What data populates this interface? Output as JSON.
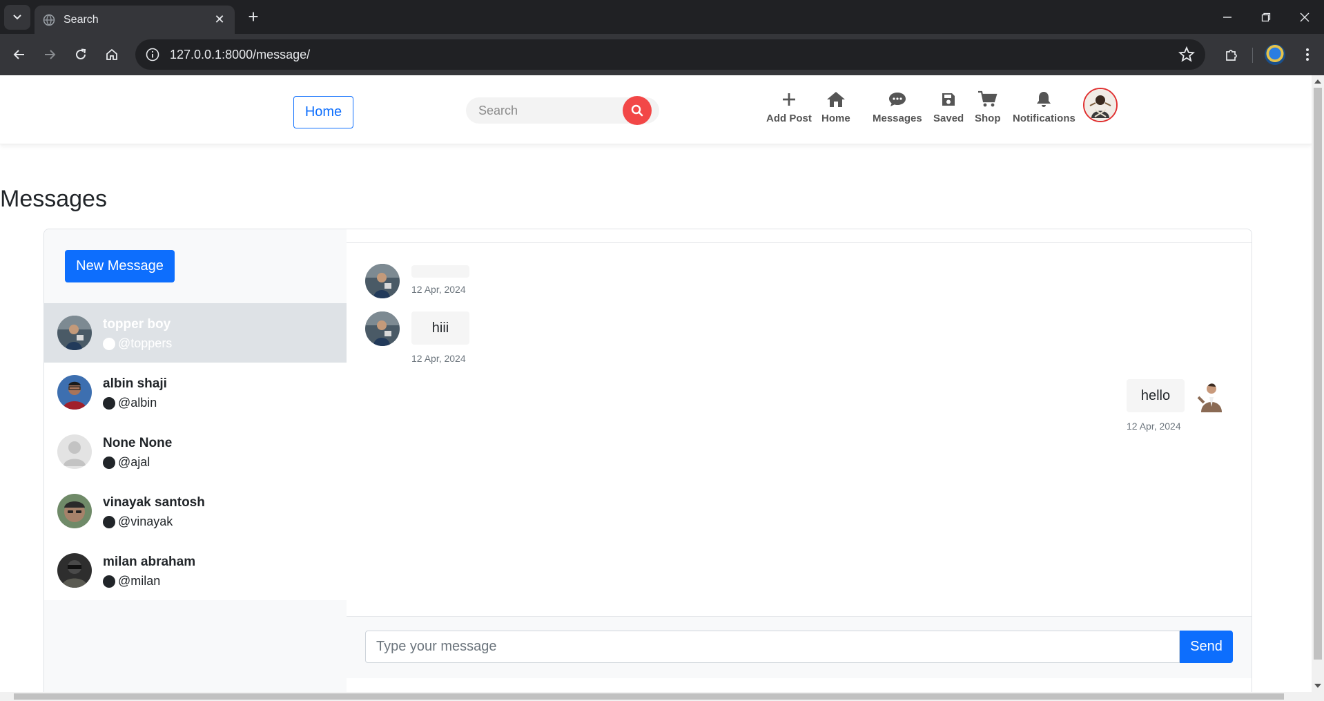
{
  "browser": {
    "tab_title": "Search",
    "url": "127.0.0.1:8000/message/"
  },
  "nav": {
    "home_label": "Home",
    "search_placeholder": "Search",
    "items": [
      {
        "label": "Add Post",
        "icon": "plus-icon"
      },
      {
        "label": "Home",
        "icon": "home-icon"
      },
      {
        "label": "Messages",
        "icon": "chat-bubble-icon"
      },
      {
        "label": "Saved",
        "icon": "floppy-disk-icon"
      },
      {
        "label": "Shop",
        "icon": "cart-icon"
      },
      {
        "label": "Notifications",
        "icon": "bell-icon"
      }
    ],
    "accent": "#f24747"
  },
  "page": {
    "title": "Messages"
  },
  "sidebar": {
    "new_message_label": "New Message",
    "contacts": [
      {
        "name": "topper boy",
        "handle": "@toppers",
        "active": true
      },
      {
        "name": "albin shaji",
        "handle": "@albin",
        "active": false
      },
      {
        "name": "None None",
        "handle": "@ajal",
        "active": false
      },
      {
        "name": "vinayak santosh",
        "handle": "@vinayak",
        "active": false
      },
      {
        "name": "milan abraham",
        "handle": "@milan",
        "active": false
      }
    ]
  },
  "chat": {
    "messages": [
      {
        "text": "",
        "time": "12 Apr, 2024",
        "from": "other"
      },
      {
        "text": "hiii",
        "time": "12 Apr, 2024",
        "from": "other"
      },
      {
        "text": "hello",
        "time": "12 Apr, 2024",
        "from": "me"
      }
    ],
    "input_placeholder": "Type your message",
    "send_label": "Send"
  },
  "colors": {
    "primary": "#0d6efd",
    "active_contact_bg": "#dee2e6"
  }
}
